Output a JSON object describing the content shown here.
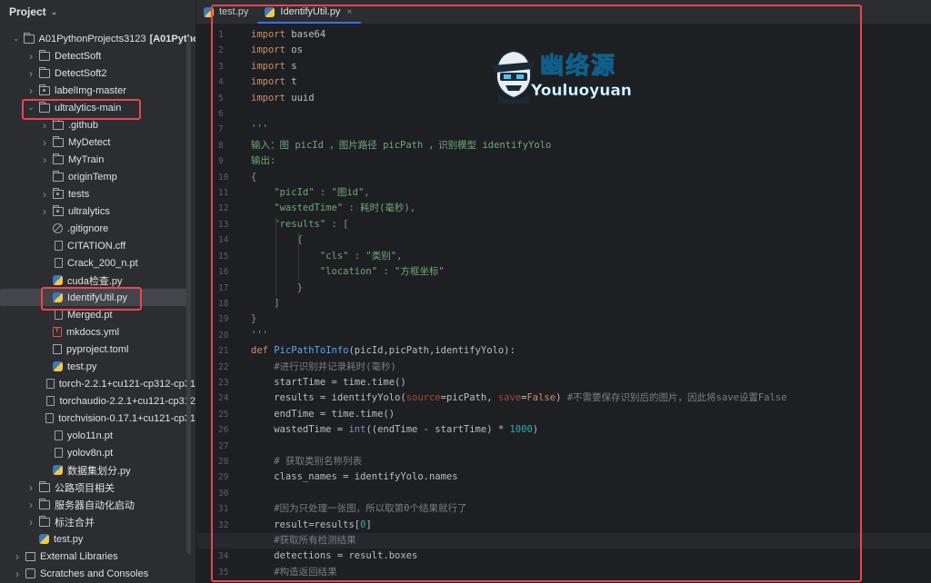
{
  "sidebar": {
    "title": "Project",
    "items": [
      {
        "label": "A01PythonProjects3123",
        "suffix": "[A01PythonP",
        "indent": 0,
        "arrow": "open",
        "icon": "folder-icon"
      },
      {
        "label": "DetectSoft",
        "indent": 1,
        "arrow": "closed",
        "icon": "folder-icon"
      },
      {
        "label": "DetectSoft2",
        "indent": 1,
        "arrow": "closed",
        "icon": "folder-icon"
      },
      {
        "label": "labelImg-master",
        "indent": 1,
        "arrow": "closed",
        "icon": "package-folder-icon"
      },
      {
        "label": "ultralytics-main",
        "indent": 1,
        "arrow": "open",
        "icon": "folder-icon"
      },
      {
        "label": ".github",
        "indent": 2,
        "arrow": "closed",
        "icon": "folder-icon"
      },
      {
        "label": "MyDetect",
        "indent": 2,
        "arrow": "closed",
        "icon": "folder-icon"
      },
      {
        "label": "MyTrain",
        "indent": 2,
        "arrow": "closed",
        "icon": "folder-icon"
      },
      {
        "label": "originTemp",
        "indent": 2,
        "arrow": "none",
        "icon": "folder-icon"
      },
      {
        "label": "tests",
        "indent": 2,
        "arrow": "closed",
        "icon": "package-folder-icon"
      },
      {
        "label": "ultralytics",
        "indent": 2,
        "arrow": "closed",
        "icon": "package-folder-icon"
      },
      {
        "label": ".gitignore",
        "indent": 2,
        "arrow": "none",
        "icon": "gitignore-icon"
      },
      {
        "label": "CITATION.cff",
        "indent": 2,
        "arrow": "none",
        "icon": "file-icon"
      },
      {
        "label": "Crack_200_n.pt",
        "indent": 2,
        "arrow": "none",
        "icon": "file-icon"
      },
      {
        "label": "cuda检查.py",
        "indent": 2,
        "arrow": "none",
        "icon": "python-file-icon"
      },
      {
        "label": "IdentifyUtil.py",
        "indent": 2,
        "arrow": "none",
        "icon": "python-file-icon",
        "selected": true
      },
      {
        "label": "Merged.pt",
        "indent": 2,
        "arrow": "none",
        "icon": "file-icon"
      },
      {
        "label": "mkdocs.yml",
        "indent": 2,
        "arrow": "none",
        "icon": "yaml-file-icon"
      },
      {
        "label": "pyproject.toml",
        "indent": 2,
        "arrow": "none",
        "icon": "toml-file-icon"
      },
      {
        "label": "test.py",
        "indent": 2,
        "arrow": "none",
        "icon": "python-file-icon"
      },
      {
        "label": "torch-2.2.1+cu121-cp312-cp31",
        "indent": 2,
        "arrow": "none",
        "icon": "file-icon"
      },
      {
        "label": "torchaudio-2.2.1+cu121-cp312",
        "indent": 2,
        "arrow": "none",
        "icon": "file-icon"
      },
      {
        "label": "torchvision-0.17.1+cu121-cp31",
        "indent": 2,
        "arrow": "none",
        "icon": "file-icon"
      },
      {
        "label": "yolo11n.pt",
        "indent": 2,
        "arrow": "none",
        "icon": "file-icon"
      },
      {
        "label": "yolov8n.pt",
        "indent": 2,
        "arrow": "none",
        "icon": "file-icon"
      },
      {
        "label": "数据集划分.py",
        "indent": 2,
        "arrow": "none",
        "icon": "python-file-icon"
      },
      {
        "label": "公路项目相关",
        "indent": 1,
        "arrow": "closed",
        "icon": "folder-icon"
      },
      {
        "label": "服务器自动化启动",
        "indent": 1,
        "arrow": "closed",
        "icon": "folder-icon"
      },
      {
        "label": "标注合并",
        "indent": 1,
        "arrow": "closed",
        "icon": "folder-icon"
      },
      {
        "label": "test.py",
        "indent": 1,
        "arrow": "none",
        "icon": "python-file-icon"
      },
      {
        "label": "External Libraries",
        "indent": 0,
        "arrow": "closed",
        "icon": "libraries-icon"
      },
      {
        "label": "Scratches and Consoles",
        "indent": 0,
        "arrow": "closed",
        "icon": "scratches-icon"
      }
    ]
  },
  "tabs": [
    {
      "label": "test.py",
      "active": false
    },
    {
      "label": "IdentifyUtil.py",
      "active": true,
      "close": "×"
    }
  ],
  "logo": {
    "title": "幽络源",
    "subtitle": "Youluoyuan"
  },
  "editor": {
    "current_line": 33,
    "line_numbers": [
      "1",
      "2",
      "3",
      "4",
      "5",
      "6",
      "7",
      "8",
      "9",
      "10",
      "11",
      "12",
      "13",
      "14",
      "15",
      "16",
      "17",
      "18",
      "19",
      "20",
      "21",
      "22",
      "23",
      "24",
      "25",
      "26",
      "27",
      "28",
      "29",
      "30",
      "31",
      "32",
      "33",
      "34",
      "35"
    ],
    "lines": [
      [
        [
          "kw",
          "import"
        ],
        [
          "lv",
          " base64"
        ]
      ],
      [
        [
          "kw",
          "import"
        ],
        [
          "lv",
          " os"
        ]
      ],
      [
        [
          "kw",
          "import"
        ],
        [
          "lv",
          " s"
        ]
      ],
      [
        [
          "kw",
          "import"
        ],
        [
          "lv",
          " t"
        ]
      ],
      [
        [
          "kw",
          "import"
        ],
        [
          "lv",
          " uuid"
        ]
      ],
      [],
      [
        [
          "str",
          "'''"
        ]
      ],
      [
        [
          "str",
          "输入：图 picId ，图片路径 picPath ，识别模型 identifyYolo"
        ]
      ],
      [
        [
          "str",
          "输出:"
        ]
      ],
      [
        [
          "str",
          "{"
        ]
      ],
      [
        [
          "str",
          "    \"picId\" : \"图id\","
        ]
      ],
      [
        [
          "str",
          "    \"wastedTime\" : 耗时(毫秒),"
        ]
      ],
      [
        [
          "str",
          "    \"results\" : ["
        ]
      ],
      [
        [
          "str",
          "        {"
        ]
      ],
      [
        [
          "str",
          "            \"cls\" : \"类别\","
        ]
      ],
      [
        [
          "str",
          "            \"location\" : \"方框坐标\""
        ]
      ],
      [
        [
          "str",
          "        }"
        ]
      ],
      [
        [
          "str",
          "    ]"
        ]
      ],
      [
        [
          "str",
          "}"
        ]
      ],
      [
        [
          "str",
          "'''"
        ]
      ],
      [
        [
          "kw",
          "def "
        ],
        [
          "fn",
          "PicPathToInfo"
        ],
        [
          "lv",
          "(picId,picPath,identifyYolo):"
        ]
      ],
      [
        [
          "lv",
          "    "
        ],
        [
          "cm",
          "#进行识别并记录耗时(毫秒)"
        ]
      ],
      [
        [
          "lv",
          "    startTime = time.time()"
        ]
      ],
      [
        [
          "lv",
          "    results = identifyYolo("
        ],
        [
          "prm",
          "source"
        ],
        [
          "lv",
          "=picPath, "
        ],
        [
          "prm",
          "save"
        ],
        [
          "lv",
          "="
        ],
        [
          "kw",
          "False"
        ],
        [
          "lv",
          ") "
        ],
        [
          "cm",
          "#不需要保存识别后的图片，因此将save设置False"
        ]
      ],
      [
        [
          "lv",
          "    endTime = time.time()"
        ]
      ],
      [
        [
          "lv",
          "    wastedTime = "
        ],
        [
          "bi",
          "int"
        ],
        [
          "lv",
          "((endTime - startTime) * "
        ],
        [
          "num",
          "1000"
        ],
        [
          "lv",
          ")"
        ]
      ],
      [],
      [
        [
          "lv",
          "    "
        ],
        [
          "cm",
          "# 获取类别名称列表"
        ]
      ],
      [
        [
          "lv",
          "    class_names = identifyYolo.names"
        ]
      ],
      [],
      [
        [
          "lv",
          "    "
        ],
        [
          "cm",
          "#因为只处理一张图，所以取第0个结果就行了"
        ]
      ],
      [
        [
          "lv",
          "    result=results["
        ],
        [
          "num",
          "0"
        ],
        [
          "lv",
          "]"
        ]
      ],
      [
        [
          "lv",
          "    "
        ],
        [
          "cm",
          "#获取所有检测结果"
        ]
      ],
      [
        [
          "lv",
          "    detections = result.boxes"
        ]
      ],
      [
        [
          "lv",
          "    "
        ],
        [
          "cm",
          "#构造返回结果"
        ]
      ]
    ]
  },
  "highlight_color": "#e8474f"
}
